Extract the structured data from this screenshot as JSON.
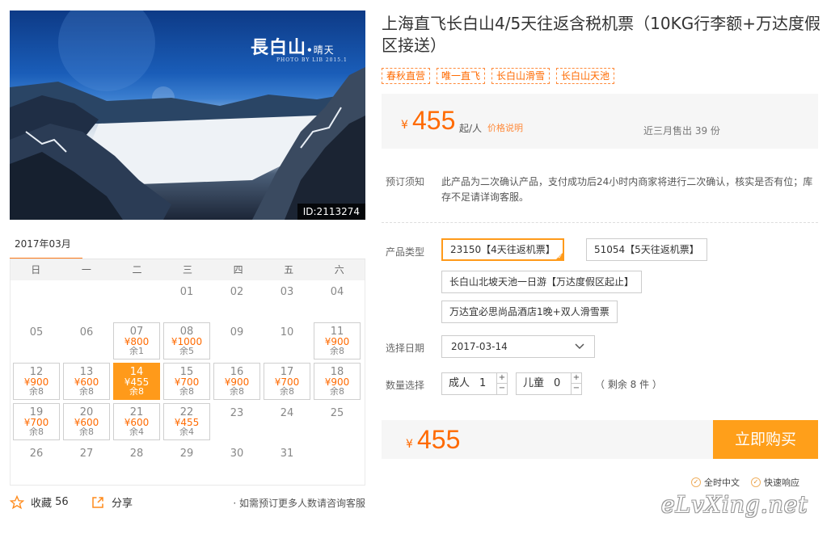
{
  "hero": {
    "title": "長白山",
    "dot": "•",
    "subtitle": "晴天",
    "credit": "PHOTO BY LIB 2015.1",
    "image_id": "ID:2113274"
  },
  "calendar": {
    "month_tab": "2017年03月",
    "weekdays": [
      "日",
      "一",
      "二",
      "三",
      "四",
      "五",
      "六"
    ],
    "days": [
      {
        "day": ""
      },
      {
        "day": ""
      },
      {
        "day": ""
      },
      {
        "day": "01"
      },
      {
        "day": "02"
      },
      {
        "day": "03"
      },
      {
        "day": "04"
      },
      {
        "day": "05"
      },
      {
        "day": "06"
      },
      {
        "day": "07",
        "price": "¥800",
        "left": "余1"
      },
      {
        "day": "08",
        "price": "¥1000",
        "left": "余5"
      },
      {
        "day": "09"
      },
      {
        "day": "10"
      },
      {
        "day": "11",
        "price": "¥900",
        "left": "余8"
      },
      {
        "day": "12",
        "price": "¥900",
        "left": "余8"
      },
      {
        "day": "13",
        "price": "¥600",
        "left": "余8"
      },
      {
        "day": "14",
        "price": "¥455",
        "left": "余8",
        "selected": true
      },
      {
        "day": "15",
        "price": "¥700",
        "left": "余8"
      },
      {
        "day": "16",
        "price": "¥900",
        "left": "余8"
      },
      {
        "day": "17",
        "price": "¥700",
        "left": "余8"
      },
      {
        "day": "18",
        "price": "¥900",
        "left": "余8"
      },
      {
        "day": "19",
        "price": "¥700",
        "left": "余8"
      },
      {
        "day": "20",
        "price": "¥600",
        "left": "余8"
      },
      {
        "day": "21",
        "price": "¥600",
        "left": "余4"
      },
      {
        "day": "22",
        "price": "¥455",
        "left": "余4"
      },
      {
        "day": "23"
      },
      {
        "day": "24"
      },
      {
        "day": "25"
      },
      {
        "day": "26"
      },
      {
        "day": "27"
      },
      {
        "day": "28"
      },
      {
        "day": "29"
      },
      {
        "day": "30"
      },
      {
        "day": "31"
      }
    ]
  },
  "actions": {
    "favorite_label": "收藏",
    "favorite_count": "56",
    "share_label": "分享",
    "consult_text": "· 如需预订更多人数请咨询客服"
  },
  "product": {
    "title": "上海直飞长白山4/5天往返含税机票（10KG行李额+万达度假区接送）",
    "tags": [
      "春秋直营",
      "唯一直飞",
      "长白山滑雪",
      "长白山天池"
    ],
    "price_yen": "¥",
    "price": "455",
    "price_unit": "起/人",
    "price_explain": "价格说明",
    "sold": "近三月售出 39 份"
  },
  "notice": {
    "label": "预订须知",
    "text": "此产品为二次确认产品，支付成功后24小时内商家将进行二次确认，核实是否有位；库存不足请详询客服。"
  },
  "options": {
    "label": "产品类型",
    "items": [
      "23150【4天往返机票】",
      "51054【5天往返机票】",
      "长白山北坡天池一日游【万达度假区起止】",
      "万达宜必思尚品酒店1晚+双人滑雪票"
    ]
  },
  "date": {
    "label": "选择日期",
    "value": "2017-03-14"
  },
  "quantity": {
    "label": "数量选择",
    "adult_label": "成人",
    "adult_value": "1",
    "child_label": "儿童",
    "child_value": "0",
    "plus": "+",
    "minus": "−",
    "remain": "（ 剩余 8 件 ）"
  },
  "buy": {
    "yen": "¥",
    "price": "455",
    "button": "立即购买"
  },
  "badges": {
    "check": "✓",
    "items": [
      "全时中文",
      "快速响应"
    ]
  },
  "watermark": "eLvXing.net",
  "colors": {
    "accent": "#ff6a00",
    "button": "#ff9f1a",
    "selected_cell": "#ff9a1a"
  }
}
